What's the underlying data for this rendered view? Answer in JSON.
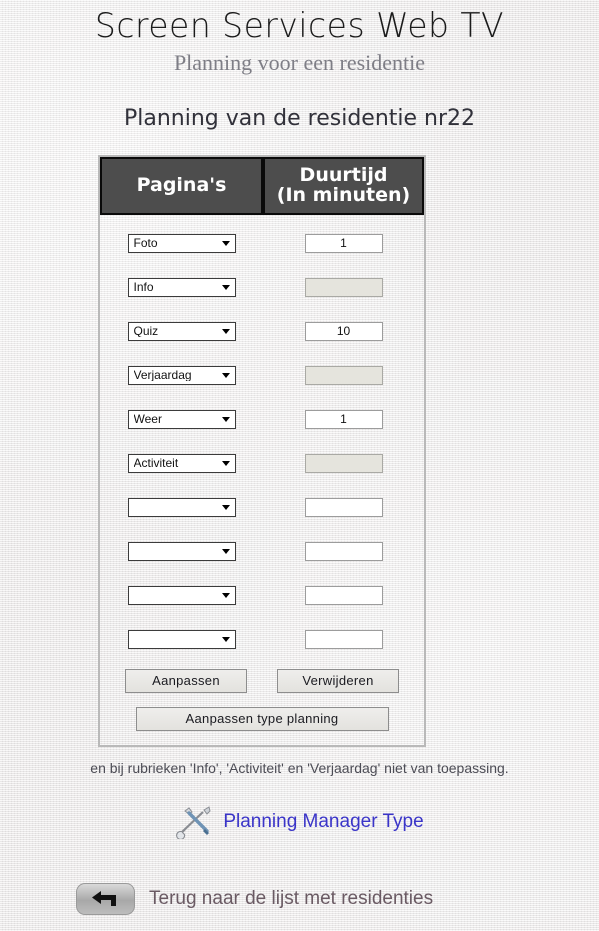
{
  "header": {
    "site_title": "Screen Services Web TV",
    "site_subtitle": "Planning voor een residentie",
    "page_heading": "Planning van de residentie nr22"
  },
  "table": {
    "columns": {
      "pages": "Pagina's",
      "duration_line1": "Duurtijd",
      "duration_line2": "(In minuten)"
    },
    "rows": [
      {
        "page": "Foto",
        "duration": "1",
        "duration_disabled": false
      },
      {
        "page": "Info",
        "duration": "",
        "duration_disabled": true
      },
      {
        "page": "Quiz",
        "duration": "10",
        "duration_disabled": false
      },
      {
        "page": "Verjaardag",
        "duration": "",
        "duration_disabled": true
      },
      {
        "page": "Weer",
        "duration": "1",
        "duration_disabled": false
      },
      {
        "page": "Activiteit",
        "duration": "",
        "duration_disabled": true
      },
      {
        "page": "",
        "duration": "",
        "duration_disabled": false
      },
      {
        "page": "",
        "duration": "",
        "duration_disabled": false
      },
      {
        "page": "",
        "duration": "",
        "duration_disabled": false
      },
      {
        "page": "",
        "duration": "",
        "duration_disabled": false
      }
    ],
    "buttons": {
      "aanpassen": "Aanpassen",
      "verwijderen": "Verwijderen",
      "aanpassen_type": "Aanpassen type planning"
    }
  },
  "footer": {
    "note": "en bij rubrieken 'Info', 'Activiteit' en 'Verjaardag' niet van toepassing.",
    "tools_link": "Planning Manager Type",
    "back_link": "Terug naar de lijst met residenties"
  },
  "colors": {
    "header_bg": "#4d4d4d",
    "header_text": "#ffffff",
    "link_blue": "#3a34c8",
    "back_text": "#6a5a63",
    "page_bg": "#eceaea",
    "disabled_input": "#e5e4dd"
  }
}
